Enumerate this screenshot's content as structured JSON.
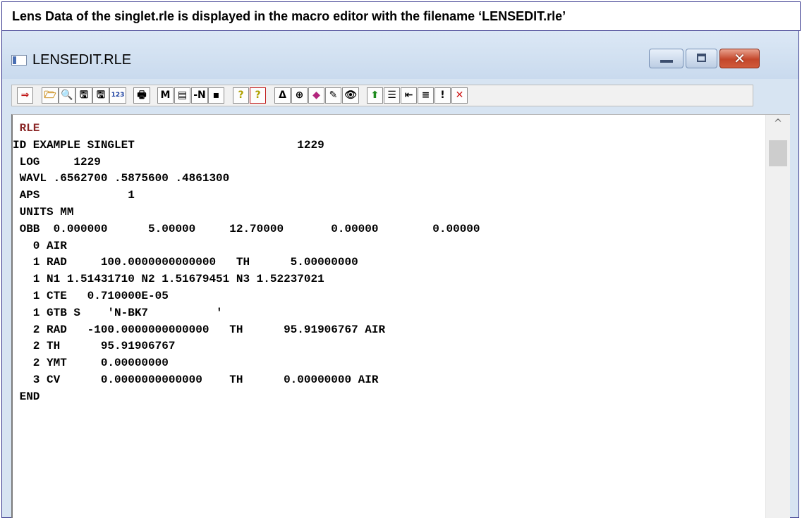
{
  "caption": "Lens Data of the singlet.rle is displayed in the macro editor with the filename ‘LENSEDIT.rle’",
  "window": {
    "title": "LENSEDIT.RLE",
    "close_glyph": "✕"
  },
  "toolbar": {
    "buttons": [
      {
        "icon": "run-icon",
        "glyph": "⇒"
      },
      {
        "icon": "open-folder-icon",
        "glyph": "🗁"
      },
      {
        "icon": "find-icon",
        "glyph": "🔍"
      },
      {
        "icon": "save-icon",
        "glyph": "🖫"
      },
      {
        "icon": "save-as-icon",
        "glyph": "🖫"
      },
      {
        "icon": "numbers-icon",
        "glyph": "123"
      },
      {
        "icon": "print-icon",
        "glyph": "🖶"
      },
      {
        "icon": "macro-icon",
        "glyph": "M"
      },
      {
        "icon": "insert-icon",
        "glyph": "▤"
      },
      {
        "icon": "negate-icon",
        "glyph": "-N"
      },
      {
        "icon": "point-icon",
        "glyph": "▪"
      },
      {
        "icon": "help-icon",
        "glyph": "?"
      },
      {
        "icon": "context-help-icon",
        "glyph": "?"
      },
      {
        "icon": "delta-icon",
        "glyph": "Δ"
      },
      {
        "icon": "target-icon",
        "glyph": "⊕"
      },
      {
        "icon": "gem-icon",
        "glyph": "◆"
      },
      {
        "icon": "wrench-icon",
        "glyph": "✎"
      },
      {
        "icon": "eye-icon",
        "glyph": "👁"
      },
      {
        "icon": "upload-icon",
        "glyph": "⬆"
      },
      {
        "icon": "indent-icon",
        "glyph": "☰"
      },
      {
        "icon": "outdent-icon",
        "glyph": "⇤"
      },
      {
        "icon": "lines-icon",
        "glyph": "≡"
      },
      {
        "icon": "exclaim-icon",
        "glyph": "!"
      },
      {
        "icon": "cancel-icon",
        "glyph": "✕"
      }
    ]
  },
  "editor": {
    "lines": [
      " RLE",
      "ID EXAMPLE SINGLET                        1229",
      " LOG     1229",
      " WAVL .6562700 .5875600 .4861300",
      " APS             1",
      " UNITS MM",
      " OBB  0.000000      5.00000     12.70000       0.00000        0.00000",
      "   0 AIR",
      "   1 RAD     100.0000000000000   TH      5.00000000",
      "   1 N1 1.51431710 N2 1.51679451 N3 1.52237021",
      "   1 CTE   0.710000E-05",
      "   1 GTB S    'N-BK7          '",
      "   2 RAD   -100.0000000000000   TH      95.91906767 AIR",
      "   2 TH      95.91906767",
      "   2 YMT     0.00000000",
      "   3 CV      0.0000000000000    TH      0.00000000 AIR",
      " END"
    ]
  },
  "scrollbar": {
    "up_glyph": "^"
  }
}
